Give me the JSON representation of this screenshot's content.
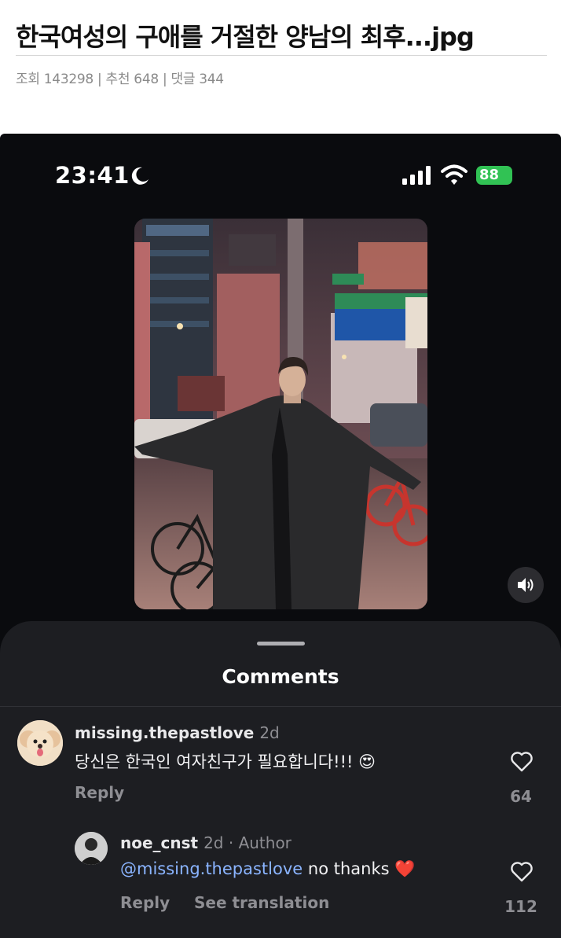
{
  "post": {
    "title": "한국여성의 구애를 거절한 양남의 최후...jpg",
    "meta": "조회 143298 | 추천 648 | 댓글 344"
  },
  "status_bar": {
    "time": "23:41",
    "battery": "88"
  },
  "comments_sheet": {
    "title": "Comments",
    "comments": [
      {
        "username": "missing.thepastlove",
        "time": "2d",
        "text": "당신은 한국인 여자친구가 필요합니다!!!",
        "emoji": "😍",
        "reply_label": "Reply",
        "likes": "64"
      },
      {
        "username": "noe_cnst",
        "time": "2d · Author",
        "mention": "@missing.thepastlove",
        "text": "no thanks",
        "emoji": "❤️",
        "reply_label": "Reply",
        "translate_label": "See translation",
        "likes": "112"
      }
    ]
  },
  "colors": {
    "accent_link": "#8ab4ff",
    "battery_green": "#31c254",
    "sheet_bg": "#1d1e22"
  }
}
